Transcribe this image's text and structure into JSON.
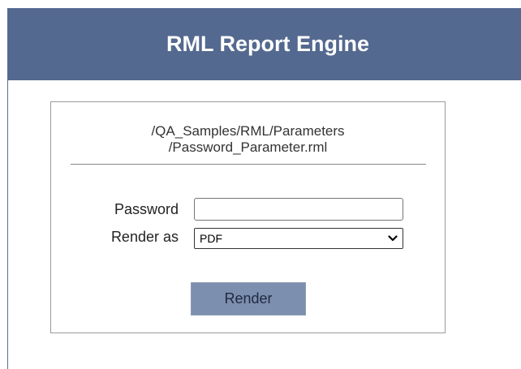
{
  "header": {
    "title": "RML Report Engine"
  },
  "report": {
    "path_line_1": "/QA_Samples/RML/Parameters",
    "path_line_2": "/Password_Parameter.rml"
  },
  "form": {
    "password_label": "Password",
    "password_value": "",
    "render_as_label": "Render as",
    "render_as_selected": "PDF",
    "render_button_label": "Render"
  },
  "icons": {
    "select_arrow": "chevron-down-icon"
  },
  "colors": {
    "header_background": "#54698f",
    "header_text": "#ffffff",
    "button_background": "#7d8faf"
  }
}
